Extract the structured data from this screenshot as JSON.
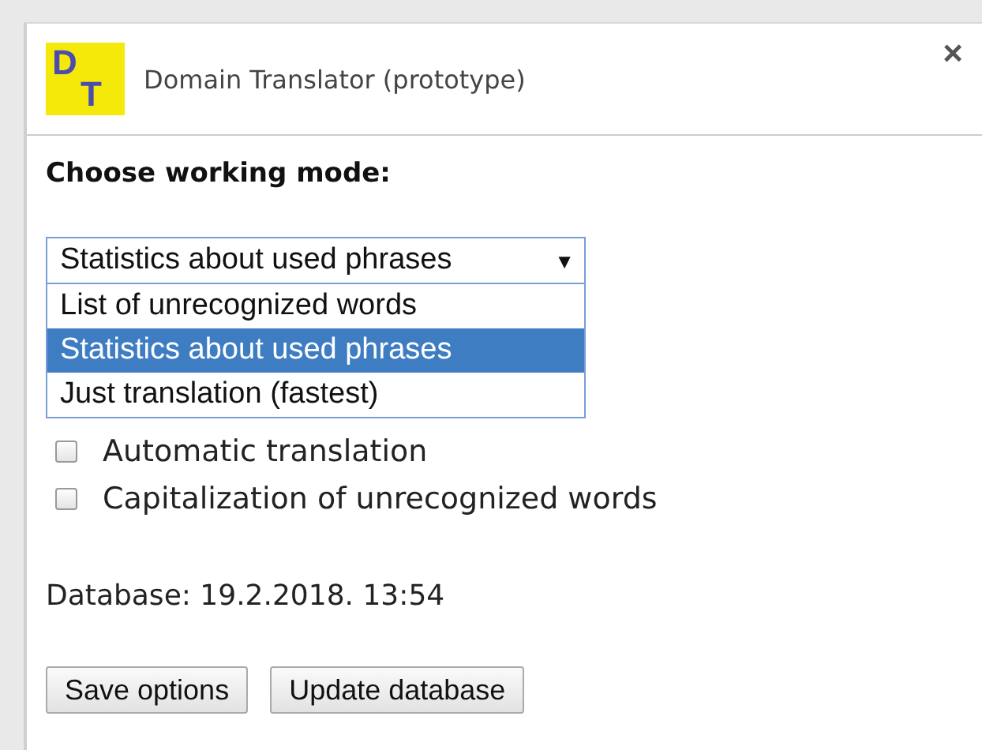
{
  "window": {
    "title": "Domain Translator (prototype)",
    "logo": [
      "D",
      "T"
    ],
    "close": "×"
  },
  "heading": "Choose working mode:",
  "mode_select": {
    "value": "Statistics about used phrases",
    "arrow": "▼",
    "expanded": true,
    "options": [
      {
        "label": "List of unrecognized words",
        "selected": false
      },
      {
        "label": "Statistics about used phrases",
        "selected": true
      },
      {
        "label": "Just translation (fastest)",
        "selected": false
      }
    ]
  },
  "options": [
    {
      "label": "Automatic translation",
      "checked": false
    },
    {
      "label": "Capitalization of unrecognized words",
      "checked": false
    }
  ],
  "database": "Database: 19.2.2018. 13:54",
  "buttons": [
    "Save options",
    "Update database"
  ]
}
